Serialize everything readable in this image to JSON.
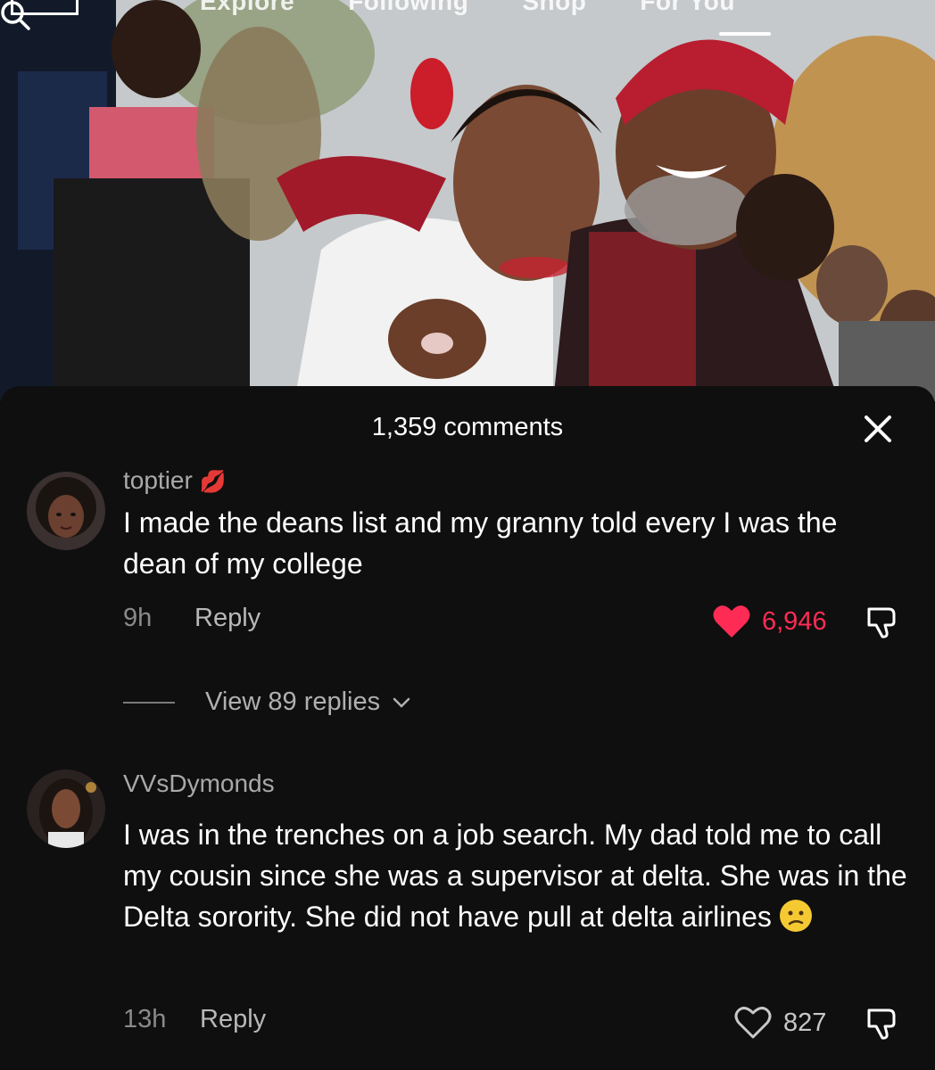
{
  "video": {
    "top_tabs": [
      "Explore",
      "Following",
      "Shop",
      "For You"
    ]
  },
  "sheet": {
    "title": "1,359 comments"
  },
  "comments": [
    {
      "username": "toptier",
      "badge_emoji": "💋",
      "text": "I made the deans list and my granny told every I was the dean of my college",
      "time": "9h",
      "reply_label": "Reply",
      "likes": "6,946",
      "liked": true,
      "view_replies": "View 89 replies"
    },
    {
      "username": "VVsDymonds",
      "text": "I was in the trenches on a job search. My dad told me to call my cousin since she was a supervisor at delta. She was in the Delta sorority. She did not have pull at delta airlines",
      "emoji": "confused-face",
      "time": "13h",
      "reply_label": "Reply",
      "likes": "827",
      "liked": false
    }
  ],
  "colors": {
    "sheet_bg": "#0f0f0f",
    "like_red": "#fe2c55",
    "muted_text": "#8a8a8a"
  }
}
